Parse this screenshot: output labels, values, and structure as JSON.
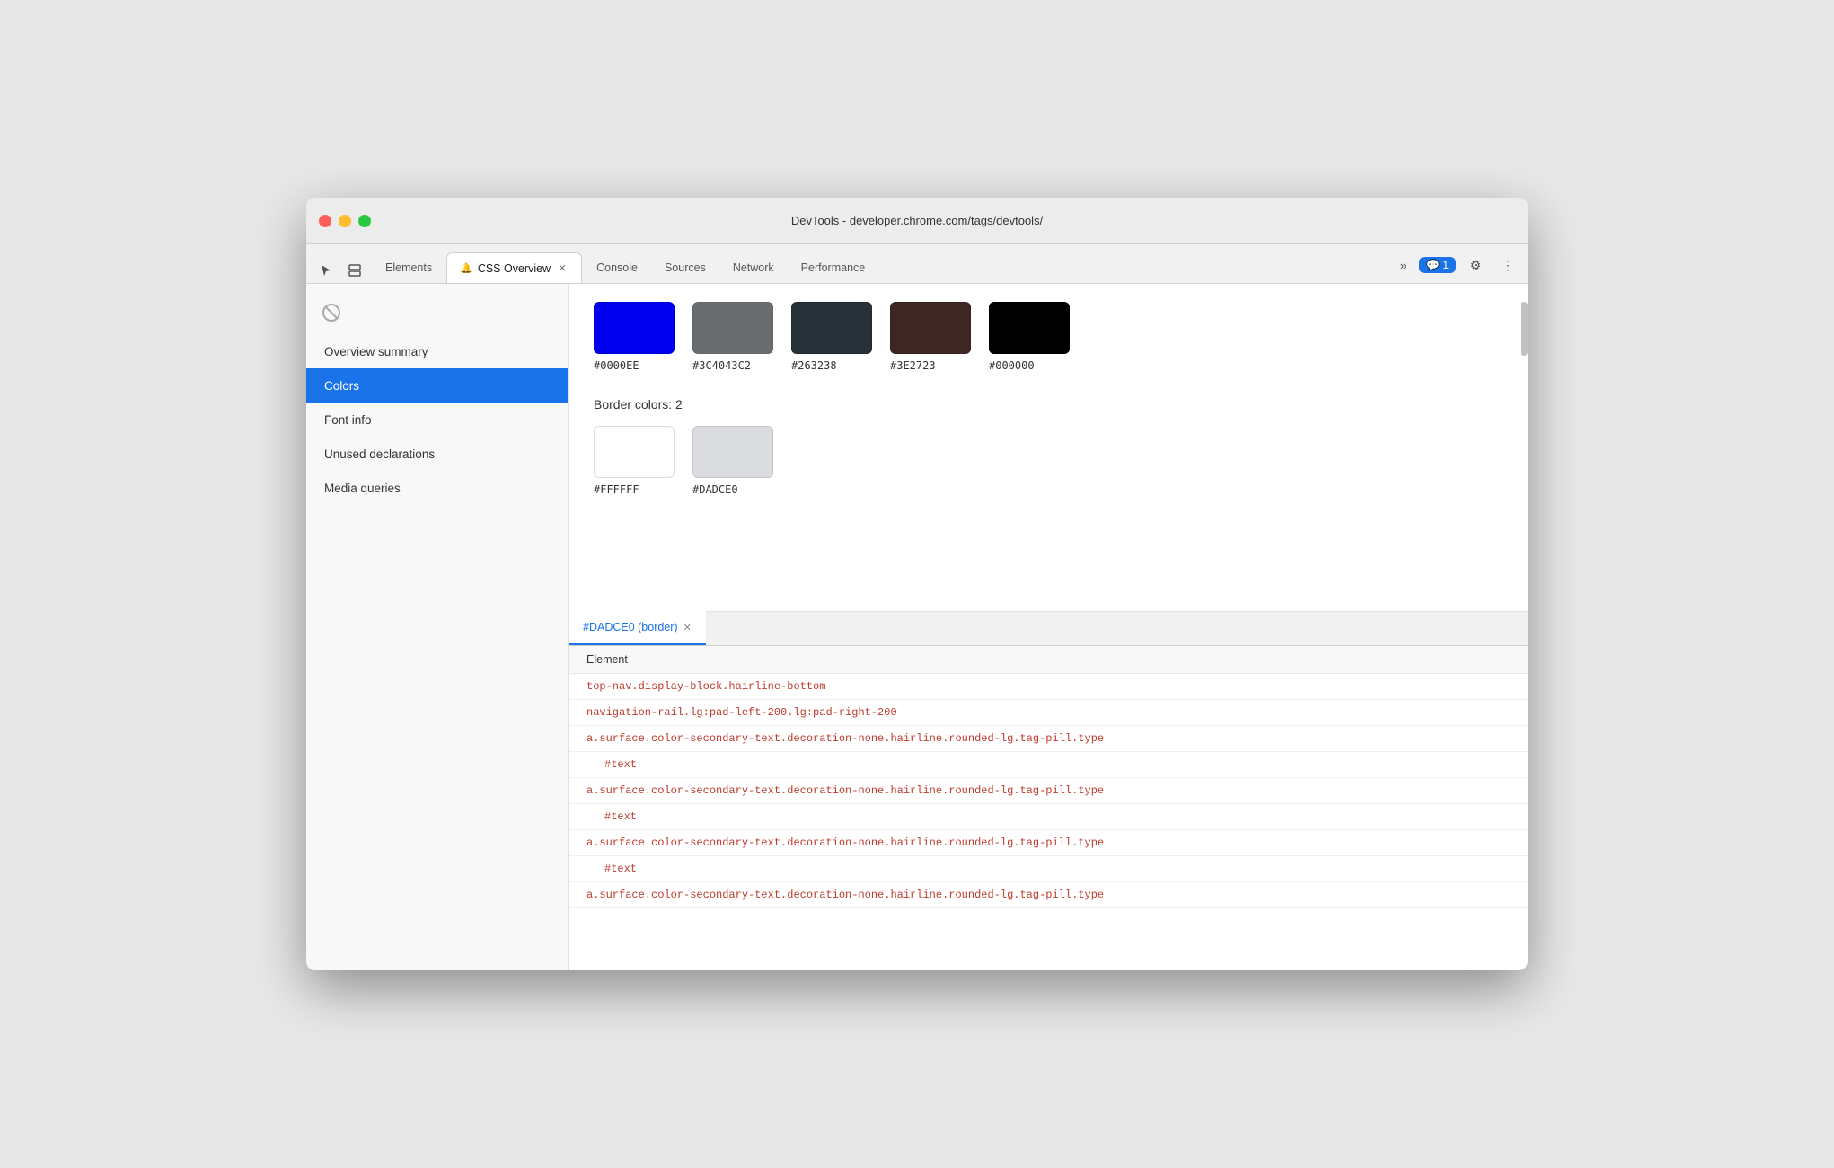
{
  "window": {
    "title": "DevTools - developer.chrome.com/tags/devtools/"
  },
  "tabs": [
    {
      "id": "elements",
      "label": "Elements",
      "active": false,
      "closeable": false
    },
    {
      "id": "css-overview",
      "label": "CSS Overview",
      "active": true,
      "closeable": true,
      "icon": "🔔"
    },
    {
      "id": "console",
      "label": "Console",
      "active": false,
      "closeable": false
    },
    {
      "id": "sources",
      "label": "Sources",
      "active": false,
      "closeable": false
    },
    {
      "id": "network",
      "label": "Network",
      "active": false,
      "closeable": false
    },
    {
      "id": "performance",
      "label": "Performance",
      "active": false,
      "closeable": false
    }
  ],
  "tab_overflow_label": "»",
  "chat_badge_label": "💬 1",
  "sidebar": {
    "items": [
      {
        "id": "overview-summary",
        "label": "Overview summary",
        "active": false
      },
      {
        "id": "colors",
        "label": "Colors",
        "active": true
      },
      {
        "id": "font-info",
        "label": "Font info",
        "active": false
      },
      {
        "id": "unused-declarations",
        "label": "Unused declarations",
        "active": false
      },
      {
        "id": "media-queries",
        "label": "Media queries",
        "active": false
      }
    ]
  },
  "content": {
    "background_colors": [
      {
        "hex": "#0000EE",
        "css": "#0000EE"
      },
      {
        "hex": "#3C4043C2",
        "css": "#3C4043C2"
      },
      {
        "hex": "#263238",
        "css": "#263238"
      },
      {
        "hex": "#3E2723",
        "css": "#3E2723"
      },
      {
        "hex": "#000000",
        "css": "#000000"
      }
    ],
    "border_colors_title": "Border colors: 2",
    "border_colors": [
      {
        "hex": "#FFFFFF",
        "css": "#FFFFFF"
      },
      {
        "hex": "#DADCE0",
        "css": "#DADCE0"
      }
    ]
  },
  "bottom_panel": {
    "tab_label": "#DADCE0 (border)",
    "elements_header": "Element",
    "rows": [
      {
        "type": "selector",
        "text": "top-nav.display-block.hairline-bottom"
      },
      {
        "type": "selector",
        "text": "navigation-rail.lg:pad-left-200.lg:pad-right-200"
      },
      {
        "type": "selector",
        "text": "a.surface.color-secondary-text.decoration-none.hairline.rounded-lg.tag-pill.type"
      },
      {
        "type": "text",
        "text": "#text"
      },
      {
        "type": "selector",
        "text": "a.surface.color-secondary-text.decoration-none.hairline.rounded-lg.tag-pill.type"
      },
      {
        "type": "text",
        "text": "#text"
      },
      {
        "type": "selector",
        "text": "a.surface.color-secondary-text.decoration-none.hairline.rounded-lg.tag-pill.type"
      },
      {
        "type": "text",
        "text": "#text"
      },
      {
        "type": "selector",
        "text": "a.surface.color-secondary-text.decoration-none.hairline.rounded-lg.tag-pill.type"
      }
    ]
  },
  "icons": {
    "cursor": "⬚",
    "layers": "⧉",
    "ban": "⊘",
    "settings": "⚙",
    "more": "⋮"
  },
  "colors": {
    "active_tab_bg": "#1a73e8",
    "active_tab_text": "#ffffff",
    "selector_color": "#c0392b",
    "text_node_color": "#c0392b"
  }
}
